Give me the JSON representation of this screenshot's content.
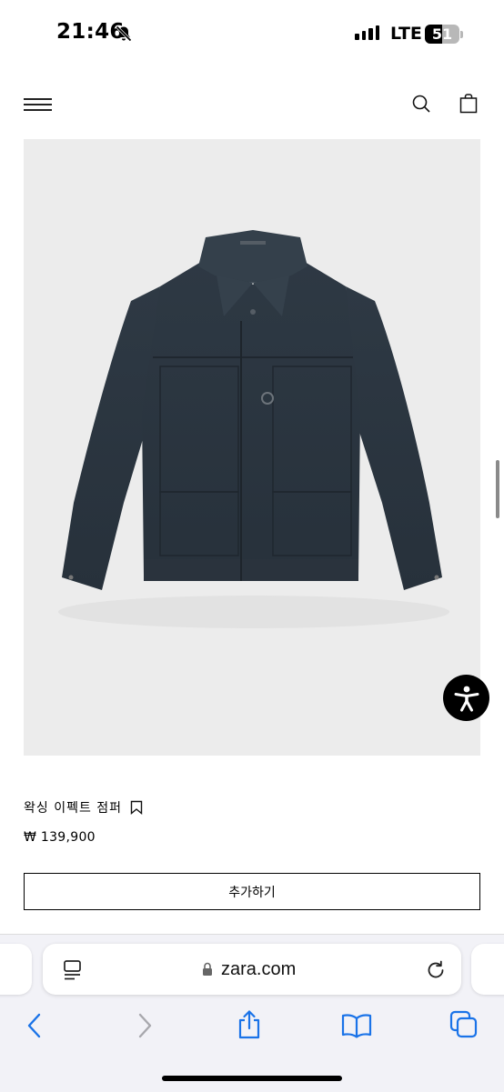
{
  "status_bar": {
    "time": "21:46",
    "network": "LTE",
    "battery": "51",
    "battery_level": 0.51
  },
  "header": {
    "menu_icon": "hamburger-menu-icon",
    "search_icon": "search-icon",
    "bag_icon": "shopping-bag-icon"
  },
  "product": {
    "name": "왁싱 이펙트 점퍼",
    "price": "₩ 139,900",
    "add_button_label": "추가하기",
    "image_subject": "jacket-photo",
    "jacket_color": "#2b3540",
    "image_bg": "#ececec"
  },
  "browser": {
    "url": "zara.com",
    "reader_icon": "reader-mode-icon",
    "reload_icon": "reload-icon",
    "nav": [
      "back-icon",
      "forward-icon",
      "share-icon",
      "bookmarks-icon",
      "tabs-icon"
    ],
    "accent_color": "#1a73e8"
  },
  "accessibility_button_icon": "accessibility-icon"
}
